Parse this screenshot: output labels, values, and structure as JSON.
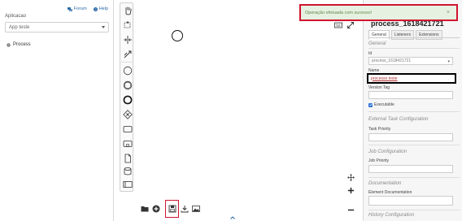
{
  "sidebar": {
    "forum_label": "Forum",
    "help_label": "Help",
    "app_label": "Aplicacao",
    "app_value": "App teste",
    "process_label": "Process"
  },
  "toast": {
    "message": "Operação efetuada com sucesso!",
    "close": "×"
  },
  "properties": {
    "title": "process_1618421721",
    "tabs": [
      "General",
      "Listeners",
      "Extensions"
    ],
    "general_group": "General",
    "id_label": "Id",
    "id_value": "process_1618421721",
    "name_label": "Name",
    "name_value": "processo teste",
    "version_tag_label": "Version Tag",
    "version_tag_value": "",
    "executable_label": "Executable",
    "external_task_group": "External Task Configuration",
    "task_priority_label": "Task Priority",
    "job_group": "Job Configuration",
    "job_priority_label": "Job Priority",
    "documentation_group": "Documentation",
    "element_doc_label": "Element Documentation",
    "history_group": "History Configuration"
  },
  "colors": {
    "accent_red": "#d0152f",
    "toast_bg": "#e7f1e1",
    "link_blue": "#2a6aa8",
    "checkbox_blue": "#2b72d6"
  },
  "icons": [
    "hand-tool-icon",
    "lasso-icon",
    "space-tool-icon",
    "connect-icon",
    "start-event-icon",
    "intermediate-event-icon",
    "end-event-icon",
    "gateway-icon",
    "task-icon",
    "subprocess-icon",
    "data-object-icon",
    "data-store-icon",
    "pool-icon",
    "open-folder-icon",
    "new-diagram-icon",
    "save-icon",
    "download-icon",
    "image-icon",
    "keyboard-icon",
    "expand-icon",
    "center-icon",
    "zoom-in-icon",
    "zoom-out-icon"
  ]
}
